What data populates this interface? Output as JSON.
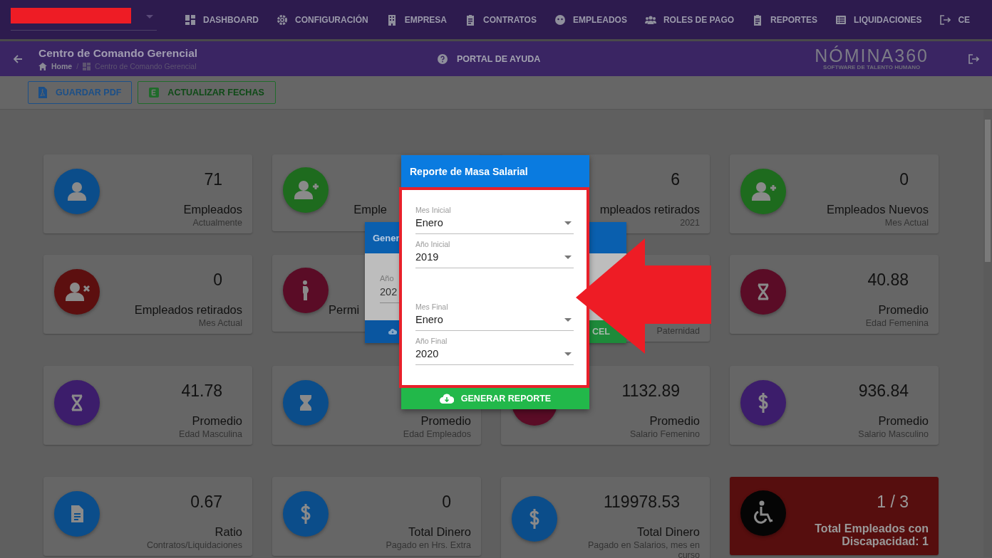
{
  "nav": [
    {
      "label": "DASHBOARD"
    },
    {
      "label": "CONFIGURACIÓN"
    },
    {
      "label": "EMPRESA"
    },
    {
      "label": "CONTRATOS"
    },
    {
      "label": "EMPLEADOS"
    },
    {
      "label": "ROLES DE PAGO"
    },
    {
      "label": "REPORTES"
    },
    {
      "label": "LIQUIDACIONES"
    },
    {
      "label": "CE"
    }
  ],
  "header": {
    "title": "Centro de Comando Gerencial",
    "breadcrumb": [
      "Home",
      "Centro de Comando Gerencial"
    ],
    "separator": "/",
    "help": "PORTAL DE AYUDA",
    "logo": "NÓMINA360",
    "logo_sub": "SOFTWARE DE TALENTO HUMANO"
  },
  "toolbar": [
    {
      "kind": "pdf",
      "label": "GUARDAR PDF"
    },
    {
      "kind": "excel",
      "label": "ACTUALIZAR FECHAS"
    }
  ],
  "cards": [
    {
      "kind": "stat",
      "color": "#0b4d8a",
      "number": "71",
      "title": "Empleados",
      "subtitle": "Actualmente"
    },
    {
      "kind": "stat",
      "color": "#1e6b1e",
      "title": "Emple"
    },
    {
      "kind": "stat",
      "number": "6",
      "title": "mpleados retirados",
      "subtitle": "2021"
    },
    {
      "kind": "stat",
      "color": "#1e6b1e",
      "number": "0",
      "title": "Empleados Nuevos",
      "subtitle": "Mes Actual"
    },
    {
      "kind": "stat",
      "color": "#5c0f0f",
      "number": "0",
      "title": "Empleados retirados",
      "subtitle": "Mes Actual"
    },
    {
      "kind": "stat",
      "color": "#5a0c26",
      "title": "Permi"
    },
    {
      "kind": "stat",
      "subtitle": "Paternidad"
    },
    {
      "kind": "stat",
      "color": "#5a0c26",
      "number": "40.88",
      "title": "Promedio",
      "subtitle": "Edad Femenina"
    },
    {
      "kind": "stat",
      "color": "#3c1d6b",
      "number": "41.78",
      "title": "Promedio",
      "subtitle": "Edad Masculina"
    },
    {
      "kind": "stat",
      "color": "#0b4d8a",
      "title": "Promedio",
      "subtitle": "Edad Empleados"
    },
    {
      "kind": "stat",
      "color": "#5a0c26",
      "number": "1132.89",
      "title": "Promedio",
      "subtitle": "Salario Femenino"
    },
    {
      "kind": "stat",
      "color": "#3c1d6b",
      "number": "936.84",
      "title": "Promedio",
      "subtitle": "Salario Masculino"
    },
    {
      "kind": "stat",
      "color": "#0b4d8a",
      "number": "0.67",
      "title": "Ratio",
      "subtitle": "Contratos/Liquidaciones"
    },
    {
      "kind": "stat",
      "color": "#0b4d8a",
      "number": "0",
      "title": "Total Dinero",
      "subtitle": "Pagado en Hrs. Extra"
    },
    {
      "kind": "stat",
      "color": "#0b4d8a",
      "number": "119978.53",
      "title": "Total Dinero",
      "subtitle": "Pagado en Salarios, mes en curso"
    },
    {
      "kind": "alert",
      "color": "#050505",
      "number": "1 / 3",
      "title": "Total Empleados con Discapacidad: 1"
    }
  ],
  "back_dialog": {
    "title": "Gener",
    "field_label": "Año",
    "field_value": "202",
    "confirm": "CEL"
  },
  "dialog": {
    "title": "Reporte de Masa Salarial",
    "fields": [
      {
        "label": "Mes Inicial",
        "value": "Enero"
      },
      {
        "label": "Año Inicial",
        "value": "2019"
      },
      {
        "label": "Mes Final",
        "value": "Enero"
      },
      {
        "label": "Año Final",
        "value": "2020"
      }
    ],
    "button": "GENERAR REPORTE"
  }
}
